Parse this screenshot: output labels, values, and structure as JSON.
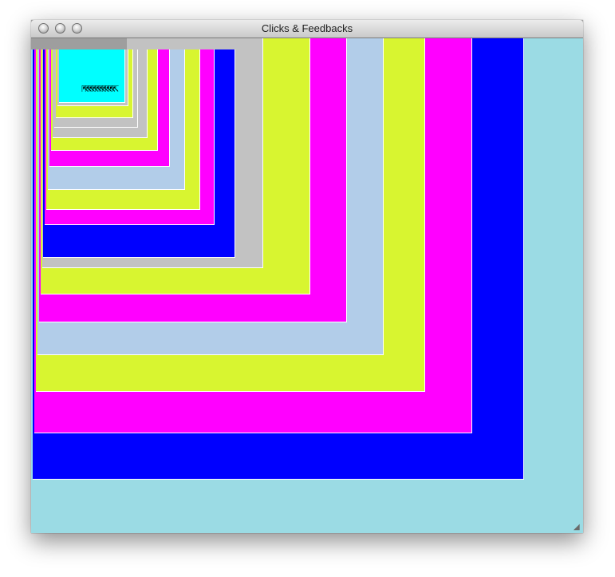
{
  "window": {
    "title": "Clicks & Feedbacks"
  },
  "cursor_glyphs": "⇱⇱⇱⇱⇱⇱⇱⇱⇱⇱",
  "colors": {
    "cyan": "#9bdbe4",
    "blue": "#0000ff",
    "magenta": "#ff00ff",
    "yellow": "#d8f530",
    "lightblue": "#b2cde9",
    "gray": "#c2c2c2",
    "aqua": "#00ffff",
    "background": "#9e9e9e"
  },
  "feedback_layers": [
    "cyan",
    "blue",
    "magenta",
    "yellow",
    "lightblue",
    "magenta",
    "yellow",
    "gray",
    "blue",
    "magenta",
    "yellow",
    "lightblue",
    "magenta",
    "yellow",
    "gray",
    "gray",
    "yellow",
    "gray",
    "aqua"
  ]
}
